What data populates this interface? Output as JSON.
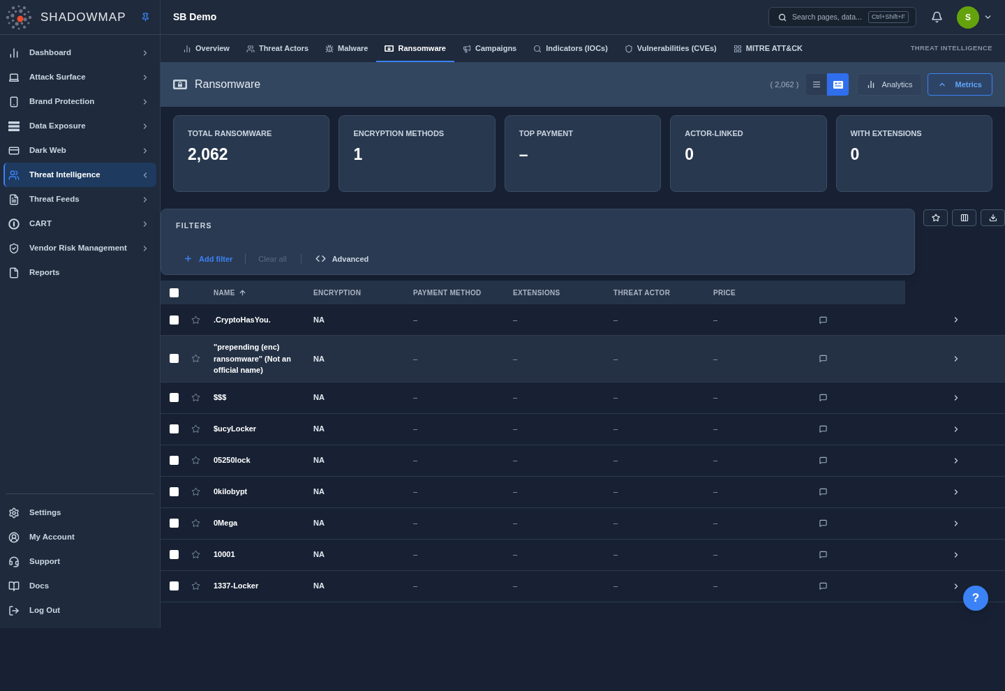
{
  "sidebar": {
    "brand": "SHADOWMAP",
    "items": [
      {
        "label": "Dashboard",
        "kind": "group",
        "selected": false
      },
      {
        "label": "Attack Surface",
        "kind": "group",
        "selected": false
      },
      {
        "label": "Brand Protection",
        "kind": "group",
        "selected": false
      },
      {
        "label": "Data Exposure",
        "kind": "group",
        "selected": false
      },
      {
        "label": "Dark Web",
        "kind": "group",
        "selected": false
      },
      {
        "label": "Threat Intelligence",
        "kind": "group",
        "selected": true
      },
      {
        "label": "Threat Feeds",
        "kind": "group",
        "selected": false
      },
      {
        "label": "CART",
        "kind": "group",
        "selected": false
      },
      {
        "label": "Vendor Risk Management",
        "kind": "group",
        "selected": false
      },
      {
        "label": "Reports",
        "kind": "link",
        "selected": false
      }
    ],
    "footer_items": [
      "Settings",
      "My Account",
      "Support",
      "Docs",
      "Log Out"
    ]
  },
  "header": {
    "title": "SB Demo",
    "search": {
      "placeholder": "Search pages, data...",
      "shortcut": "Ctrl+Shift+F"
    },
    "avatar": "S"
  },
  "tabs": [
    {
      "label": "Overview",
      "selected": false
    },
    {
      "label": "Threat Actors",
      "selected": false
    },
    {
      "label": "Malware",
      "selected": false
    },
    {
      "label": "Ransomware",
      "selected": true
    },
    {
      "label": "Campaigns",
      "selected": false
    },
    {
      "label": "Indicators (IOCs)",
      "selected": false
    },
    {
      "label": "Vulnerabilities (CVEs)",
      "selected": false
    },
    {
      "label": "MITRE ATT&CK",
      "selected": false
    }
  ],
  "section_label": "THREAT INTELLIGENCE",
  "page": {
    "title": "Ransomware",
    "count": "( 2,062 )",
    "view_modes": [
      {
        "kind": "list",
        "selected": false
      },
      {
        "kind": "cards",
        "selected": true
      }
    ],
    "analytics": "Analytics",
    "metrics": {
      "label": "Metrics",
      "expanded": true
    }
  },
  "stats": [
    {
      "label": "TOTAL RANSOMWARE",
      "value": "2,062"
    },
    {
      "label": "ENCRYPTION METHODS",
      "value": "1"
    },
    {
      "label": "TOP PAYMENT",
      "value": "–"
    },
    {
      "label": "ACTOR-LINKED",
      "value": "0"
    },
    {
      "label": "WITH EXTENSIONS",
      "value": "0"
    }
  ],
  "filters": {
    "title": "FILTERS",
    "add": "Add filter",
    "clear": {
      "label": "Clear all",
      "disabled": true
    },
    "advanced": "Advanced"
  },
  "table": {
    "all_checked": false,
    "columns": [
      {
        "label": "NAME",
        "sorted": true
      },
      {
        "label": "ENCRYPTION",
        "sorted": false
      },
      {
        "label": "PAYMENT METHOD",
        "sorted": false
      },
      {
        "label": "EXTENSIONS",
        "sorted": false
      },
      {
        "label": "THREAT ACTOR",
        "sorted": false
      },
      {
        "label": "PRICE",
        "sorted": false
      }
    ],
    "rows": [
      {
        "checked": false,
        "starred": false,
        "highlighted": false,
        "cells": [
          ".CryptoHasYou.",
          "NA",
          "–",
          "–",
          "–",
          "–"
        ]
      },
      {
        "checked": false,
        "starred": false,
        "highlighted": true,
        "cells": [
          "\"prepending (enc) ransomware\" (Not an official name)",
          "NA",
          "–",
          "–",
          "–",
          "–"
        ]
      },
      {
        "checked": false,
        "starred": false,
        "highlighted": false,
        "cells": [
          "$$$",
          "NA",
          "–",
          "–",
          "–",
          "–"
        ]
      },
      {
        "checked": false,
        "starred": false,
        "highlighted": false,
        "cells": [
          "$ucyLocker",
          "NA",
          "–",
          "–",
          "–",
          "–"
        ]
      },
      {
        "checked": false,
        "starred": false,
        "highlighted": false,
        "cells": [
          "05250lock",
          "NA",
          "–",
          "–",
          "–",
          "–"
        ]
      },
      {
        "checked": false,
        "starred": false,
        "highlighted": false,
        "cells": [
          "0kilobypt",
          "NA",
          "–",
          "–",
          "–",
          "–"
        ]
      },
      {
        "checked": false,
        "starred": false,
        "highlighted": false,
        "cells": [
          "0Mega",
          "NA",
          "–",
          "–",
          "–",
          "–"
        ]
      },
      {
        "checked": false,
        "starred": false,
        "highlighted": false,
        "cells": [
          "10001",
          "NA",
          "–",
          "–",
          "–",
          "–"
        ]
      },
      {
        "checked": false,
        "starred": false,
        "highlighted": false,
        "cells": [
          "1337-Locker",
          "NA",
          "–",
          "–",
          "–",
          "–"
        ]
      }
    ]
  },
  "help_button": "?"
}
